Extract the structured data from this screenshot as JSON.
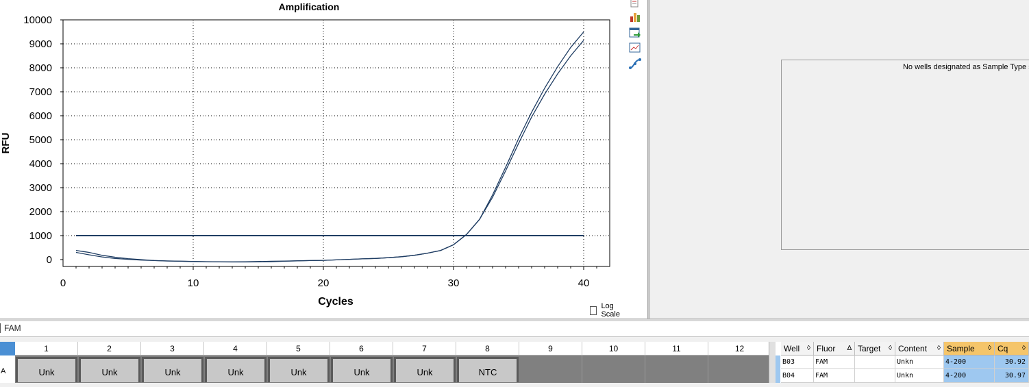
{
  "chart_data": {
    "type": "line",
    "title": "Amplification",
    "xlabel": "Cycles",
    "ylabel": "RFU",
    "xlim": [
      0,
      42
    ],
    "ylim": [
      -300,
      10000
    ],
    "x_ticks": [
      0,
      10,
      20,
      30,
      40
    ],
    "y_ticks": [
      0,
      1000,
      2000,
      3000,
      4000,
      5000,
      6000,
      7000,
      8000,
      9000,
      10000
    ],
    "grid": true,
    "legend": "none",
    "series": [
      {
        "x": [
          1,
          2,
          3,
          4,
          5,
          6,
          7,
          8,
          9,
          10,
          11,
          12,
          13,
          14,
          15,
          16,
          17,
          18,
          19,
          20,
          21,
          22,
          23,
          24,
          25,
          26,
          27,
          28,
          29,
          30,
          31,
          32,
          33,
          34,
          35,
          36,
          37,
          38,
          39,
          40
        ],
        "values": [
          380,
          300,
          180,
          100,
          40,
          0,
          -40,
          -60,
          -70,
          -80,
          -90,
          -95,
          -95,
          -90,
          -80,
          -70,
          -60,
          -50,
          -40,
          -30,
          -10,
          10,
          30,
          50,
          80,
          120,
          180,
          270,
          380,
          620,
          1050,
          1680,
          2600,
          3700,
          4850,
          5950,
          6900,
          7750,
          8500,
          9150
        ]
      },
      {
        "x": [
          1,
          2,
          3,
          4,
          5,
          6,
          7,
          8,
          9,
          10,
          11,
          12,
          13,
          14,
          15,
          16,
          17,
          18,
          19,
          20,
          21,
          22,
          23,
          24,
          25,
          26,
          27,
          28,
          29,
          30,
          31,
          32,
          33,
          34,
          35,
          36,
          37,
          38,
          39,
          40
        ],
        "values": [
          300,
          200,
          110,
          50,
          10,
          -20,
          -40,
          -55,
          -65,
          -75,
          -85,
          -95,
          -100,
          -100,
          -95,
          -90,
          -70,
          -50,
          -40,
          -30,
          -10,
          10,
          30,
          50,
          80,
          120,
          180,
          270,
          380,
          620,
          1050,
          1680,
          2700,
          3850,
          5050,
          6150,
          7150,
          8050,
          8850,
          9500
        ]
      }
    ],
    "threshold": 1000
  },
  "colors": {
    "curve": "#1f3d63",
    "threshold": "#1f3d63",
    "selected_header": "#f5c56a",
    "selected_cell": "#9ec8f0"
  },
  "toolbar": {
    "icons": [
      "copy-icon",
      "chart-bars-icon",
      "export-icon",
      "zoom-chart-icon",
      "curve-icon"
    ]
  },
  "standard_curve": {
    "message": "No wells designated as Sample Type standard"
  },
  "log_scale": {
    "label": "Log Scale",
    "checked": false
  },
  "fluor_selector": {
    "label": "FAM"
  },
  "plate": {
    "row_label": "A",
    "columns": [
      "1",
      "2",
      "3",
      "4",
      "5",
      "6",
      "7",
      "8",
      "9",
      "10",
      "11",
      "12"
    ],
    "wells": [
      "Unk",
      "Unk",
      "Unk",
      "Unk",
      "Unk",
      "Unk",
      "Unk",
      "NTC",
      "",
      "",
      "",
      ""
    ]
  },
  "results": {
    "headers": [
      "Well",
      "Fluor",
      "Target",
      "Content",
      "Sample",
      "Cq"
    ],
    "sort_marks": [
      "◊",
      "∆",
      "◊",
      "◊",
      "◊",
      "◊"
    ],
    "rows": [
      [
        "B03",
        "FAM",
        "",
        "Unkn",
        "4-200",
        "30.92"
      ],
      [
        "B04",
        "FAM",
        "",
        "Unkn",
        "4-200",
        "30.97"
      ]
    ]
  }
}
